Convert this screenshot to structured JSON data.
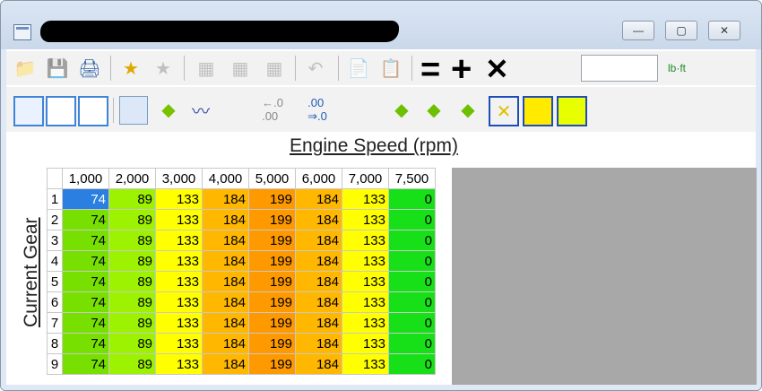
{
  "window": {
    "title": ""
  },
  "titlebar": {
    "buttons": [
      "—",
      "▢",
      "✕"
    ]
  },
  "toolbar1": {
    "symbols": {
      "equals": "=",
      "plus": "+",
      "times": "✕"
    },
    "value_input": "",
    "unit": "lb·ft"
  },
  "toolbar2": {
    "decimal_less": "←.0\n.00",
    "decimal_more": ".00\n⇒.0"
  },
  "table": {
    "x_axis_label": "Engine Speed (rpm)",
    "y_axis_label": "Current Gear",
    "columns": [
      "1,000",
      "2,000",
      "3,000",
      "4,000",
      "5,000",
      "6,000",
      "7,000",
      "7,500"
    ],
    "rows": [
      "1",
      "2",
      "3",
      "4",
      "5",
      "6",
      "7",
      "8",
      "9"
    ],
    "values": [
      [
        "74",
        "89",
        "133",
        "184",
        "199",
        "184",
        "133",
        "0"
      ],
      [
        "74",
        "89",
        "133",
        "184",
        "199",
        "184",
        "133",
        "0"
      ],
      [
        "74",
        "89",
        "133",
        "184",
        "199",
        "184",
        "133",
        "0"
      ],
      [
        "74",
        "89",
        "133",
        "184",
        "199",
        "184",
        "133",
        "0"
      ],
      [
        "74",
        "89",
        "133",
        "184",
        "199",
        "184",
        "133",
        "0"
      ],
      [
        "74",
        "89",
        "133",
        "184",
        "199",
        "184",
        "133",
        "0"
      ],
      [
        "74",
        "89",
        "133",
        "184",
        "199",
        "184",
        "133",
        "0"
      ],
      [
        "74",
        "89",
        "133",
        "184",
        "199",
        "184",
        "133",
        "0"
      ],
      [
        "74",
        "89",
        "133",
        "184",
        "199",
        "184",
        "133",
        "0"
      ]
    ],
    "column_colors": [
      "#78e000",
      "#9cf200",
      "#ffff00",
      "#ffb700",
      "#ff9900",
      "#ffb700",
      "#ffff00",
      "#18e018"
    ],
    "selected_cell": {
      "row": 0,
      "col": 0
    }
  }
}
